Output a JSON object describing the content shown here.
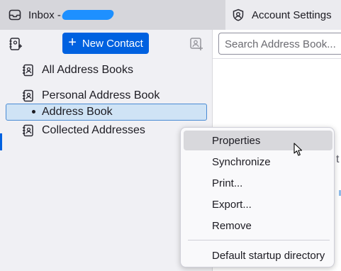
{
  "tabs": {
    "inbox_label": "Inbox -",
    "settings_label": "Account Settings"
  },
  "sidebar": {
    "new_contact_label": "New Contact",
    "items": [
      {
        "label": "All Address Books"
      },
      {
        "label": "Personal Address Book"
      },
      {
        "label": "Address Book"
      },
      {
        "label": "Collected Addresses"
      }
    ]
  },
  "search": {
    "placeholder": "Search Address Book..."
  },
  "peek": {
    "text": "t"
  },
  "context_menu": {
    "items": [
      {
        "label": "Properties"
      },
      {
        "label": "Synchronize"
      },
      {
        "label": "Print..."
      },
      {
        "label": "Export..."
      },
      {
        "label": "Remove"
      },
      {
        "label": "Default startup directory"
      }
    ]
  },
  "colors": {
    "accent": "#0061e0",
    "selection": "#cfe3f5",
    "redaction": "#1e90ff"
  },
  "icons": [
    "inbox-icon",
    "account-settings-icon",
    "new-address-book-icon",
    "plus-icon",
    "new-contact-list-icon",
    "address-book-icon",
    "mouse-cursor-icon"
  ]
}
